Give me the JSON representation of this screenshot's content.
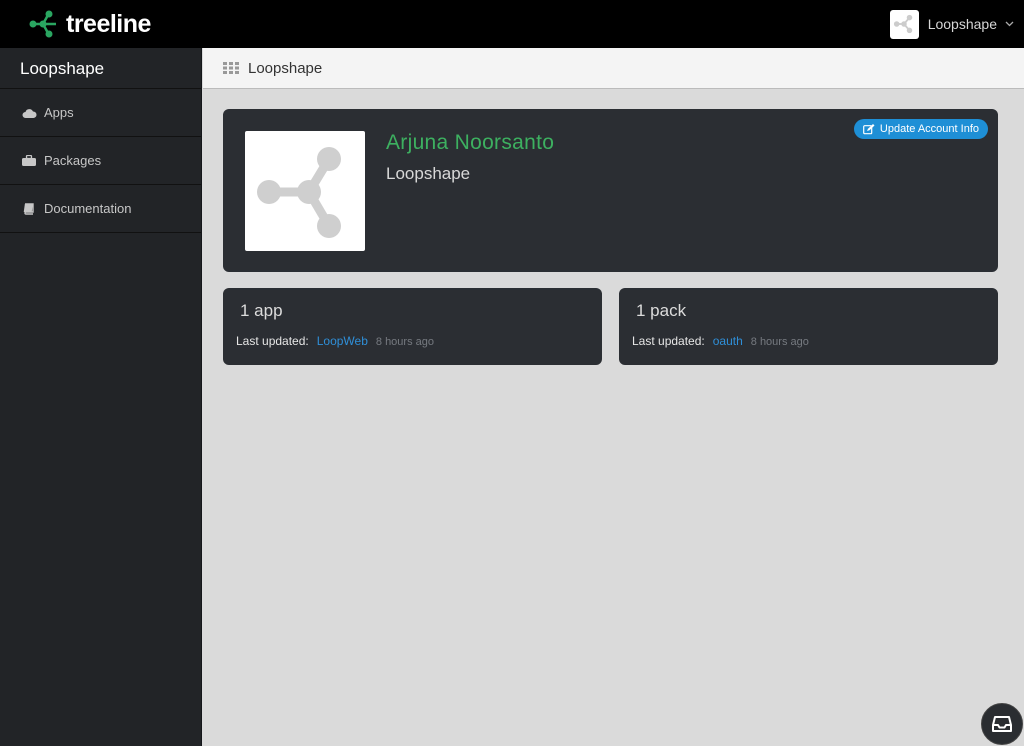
{
  "brand": {
    "name": "treeline"
  },
  "account": {
    "name": "Loopshape",
    "chevron": "⌄"
  },
  "sidebar": {
    "title": "Loopshape",
    "items": [
      {
        "label": "Apps",
        "icon": "cloud-icon"
      },
      {
        "label": "Packages",
        "icon": "briefcase-icon"
      },
      {
        "label": "Documentation",
        "icon": "book-icon"
      }
    ]
  },
  "breadcrumb": {
    "label": "Loopshape",
    "icon": "grid-icon"
  },
  "profile": {
    "name": "Arjuna Noorsanto",
    "organization": "Loopshape",
    "update_button": "Update Account Info"
  },
  "stats": {
    "apps": {
      "count": "1 app",
      "label": "Last updated:",
      "link": "LoopWeb",
      "time": "8 hours ago"
    },
    "packs": {
      "count": "1 pack",
      "label": "Last updated:",
      "link": "oauth",
      "time": "8 hours ago"
    }
  },
  "colors": {
    "accent_green": "#3db060",
    "link_blue": "#2f8fd8",
    "button_blue": "#1e8fd6",
    "card_bg": "#2b2e33"
  }
}
